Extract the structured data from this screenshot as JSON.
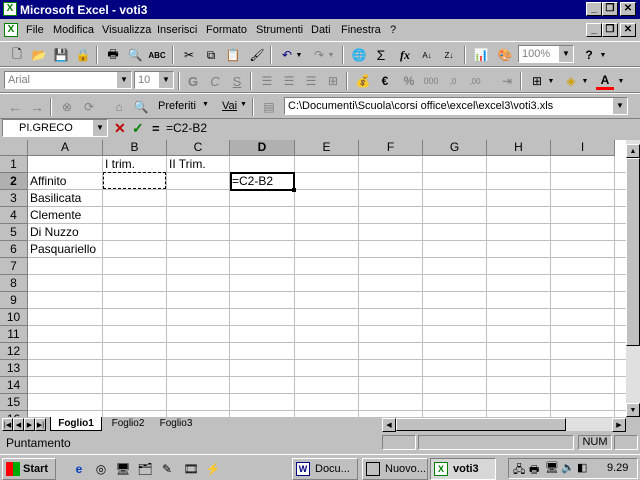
{
  "window": {
    "title": "Microsoft Excel - voti3"
  },
  "menu": [
    "File",
    "Modifica",
    "Visualizza",
    "Inserisci",
    "Formato",
    "Strumenti",
    "Dati",
    "Finestra",
    "?"
  ],
  "toolbar_standard": {
    "zoom": "100%"
  },
  "toolbar_format": {
    "font": "Arial",
    "size": "10"
  },
  "web_toolbar": {
    "favorites": "Preferiti",
    "goto": "Vai",
    "address": "C:\\Documenti\\Scuola\\corsi office\\excel\\excel3\\voti3.xls"
  },
  "formula_bar": {
    "name_box": "PI.GRECO",
    "cancel": "✕",
    "enter": "✓",
    "equals": "=",
    "content": "=C2-B2"
  },
  "grid": {
    "columns": [
      "A",
      "B",
      "C",
      "D",
      "E",
      "F",
      "G",
      "H",
      "I"
    ],
    "rows": [
      "1",
      "2",
      "3",
      "4",
      "5",
      "6",
      "7",
      "8",
      "9",
      "10",
      "11",
      "12",
      "13",
      "14",
      "15",
      "16"
    ],
    "cells": {
      "B1": "I trim.",
      "C1": "II Trim.",
      "A2": "Affinito",
      "A3": "Basilicata",
      "A4": "Clemente",
      "A5": "Di Nuzzo",
      "A6": "Pasquariello",
      "D2": "=C2-B2"
    }
  },
  "sheets": [
    "Foglio1",
    "Foglio2",
    "Foglio3"
  ],
  "status": {
    "mode": "Puntamento",
    "num": "NUM"
  },
  "taskbar": {
    "start": "Start",
    "tasks": [
      "Docu...",
      "Nuovo...",
      "voti3"
    ],
    "clock": "9.29"
  }
}
